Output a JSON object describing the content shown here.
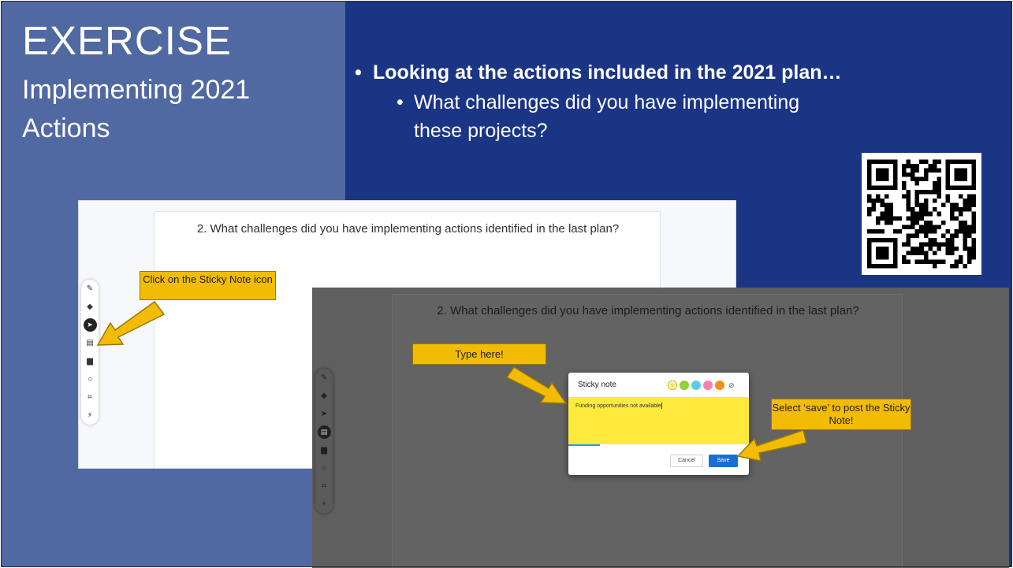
{
  "slide": {
    "title": "EXERCISE",
    "subtitle": "Implementing 2021 Actions",
    "bullet_main": "Looking at the actions included in the 2021 plan…",
    "bullet_sub": "What challenges did you have implementing these projects?"
  },
  "screenshot_back": {
    "question": "2. What challenges did you have implementing actions identified in the last plan?",
    "callout": "Click on the Sticky Note icon"
  },
  "screenshot_front": {
    "question": "2. What challenges did you have implementing actions identified in the last plan?",
    "callout_type": "Type here!",
    "callout_save": "Select ‘save’ to post the Sticky Note!",
    "dialog": {
      "title": "Sticky note",
      "note_text": "Funding opportunities not available",
      "cancel_label": "Cancel",
      "save_label": "Save"
    }
  },
  "toolbar_icons": [
    "pen-icon",
    "eraser-icon",
    "select-arrow-icon",
    "sticky-note-icon",
    "image-icon",
    "shape-icon",
    "frame-icon",
    "laser-icon"
  ],
  "colors": {
    "left_panel": "#5069a2",
    "right_panel": "#1b3585",
    "callout": "#f2bc05",
    "note_yellow": "#fdea3c",
    "save_button": "#1a6ed8",
    "swatches": [
      "#f7e84a",
      "#8fd33b",
      "#5ccde8",
      "#f77fb7",
      "#f39019"
    ]
  }
}
